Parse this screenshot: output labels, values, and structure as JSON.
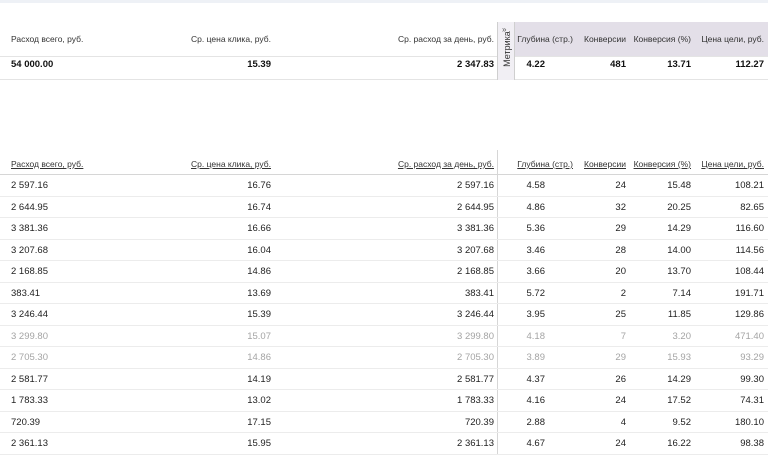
{
  "summary": {
    "headers": {
      "spend_total": "Расход всего, руб.",
      "avg_cpc": "Ср. цена клика, руб.",
      "avg_daily_spend": "Ср. расход за день, руб.",
      "depth": "Глубина (стр.)",
      "conversions": "Конверсии",
      "conversion_rate": "Конверсия (%)",
      "goal_cost": "Цена цели, руб."
    },
    "values": {
      "spend_total": "54 000.00",
      "avg_cpc": "15.39",
      "avg_daily_spend": "2 347.83",
      "depth": "4.22",
      "conversions": "481",
      "conversion_rate": "13.71",
      "goal_cost": "112.27"
    },
    "metrika_tab": {
      "label": "Метрика",
      "arrow": "»"
    }
  },
  "table": {
    "columns": {
      "spend_total": "Расход всего, руб.",
      "avg_cpc": "Ср. цена клика, руб.",
      "avg_daily_spend": "Ср. расход за день, руб.",
      "depth": "Глубина (стр.)",
      "conversions": "Конверсии",
      "conversion_rate": "Конверсия (%)",
      "goal_cost": "Цена цели, руб."
    },
    "rows": [
      {
        "spend": "2 597.16",
        "cpc": "16.76",
        "daily": "2 597.16",
        "depth": "4.58",
        "conv": "24",
        "rate": "15.48",
        "goal": "108.21",
        "dim": false
      },
      {
        "spend": "2 644.95",
        "cpc": "16.74",
        "daily": "2 644.95",
        "depth": "4.86",
        "conv": "32",
        "rate": "20.25",
        "goal": "82.65",
        "dim": false
      },
      {
        "spend": "3 381.36",
        "cpc": "16.66",
        "daily": "3 381.36",
        "depth": "5.36",
        "conv": "29",
        "rate": "14.29",
        "goal": "116.60",
        "dim": false
      },
      {
        "spend": "3 207.68",
        "cpc": "16.04",
        "daily": "3 207.68",
        "depth": "3.46",
        "conv": "28",
        "rate": "14.00",
        "goal": "114.56",
        "dim": false
      },
      {
        "spend": "2 168.85",
        "cpc": "14.86",
        "daily": "2 168.85",
        "depth": "3.66",
        "conv": "20",
        "rate": "13.70",
        "goal": "108.44",
        "dim": false
      },
      {
        "spend": "383.41",
        "cpc": "13.69",
        "daily": "383.41",
        "depth": "5.72",
        "conv": "2",
        "rate": "7.14",
        "goal": "191.71",
        "dim": false
      },
      {
        "spend": "3 246.44",
        "cpc": "15.39",
        "daily": "3 246.44",
        "depth": "3.95",
        "conv": "25",
        "rate": "11.85",
        "goal": "129.86",
        "dim": false
      },
      {
        "spend": "3 299.80",
        "cpc": "15.07",
        "daily": "3 299.80",
        "depth": "4.18",
        "conv": "7",
        "rate": "3.20",
        "goal": "471.40",
        "dim": true
      },
      {
        "spend": "2 705.30",
        "cpc": "14.86",
        "daily": "2 705.30",
        "depth": "3.89",
        "conv": "29",
        "rate": "15.93",
        "goal": "93.29",
        "dim": true
      },
      {
        "spend": "2 581.77",
        "cpc": "14.19",
        "daily": "2 581.77",
        "depth": "4.37",
        "conv": "26",
        "rate": "14.29",
        "goal": "99.30",
        "dim": false
      },
      {
        "spend": "1 783.33",
        "cpc": "13.02",
        "daily": "1 783.33",
        "depth": "4.16",
        "conv": "24",
        "rate": "17.52",
        "goal": "74.31",
        "dim": false
      },
      {
        "spend": "720.39",
        "cpc": "17.15",
        "daily": "720.39",
        "depth": "2.88",
        "conv": "4",
        "rate": "9.52",
        "goal": "180.10",
        "dim": false
      },
      {
        "spend": "2 361.13",
        "cpc": "15.95",
        "daily": "2 361.13",
        "depth": "4.67",
        "conv": "24",
        "rate": "16.22",
        "goal": "98.38",
        "dim": false
      }
    ]
  }
}
